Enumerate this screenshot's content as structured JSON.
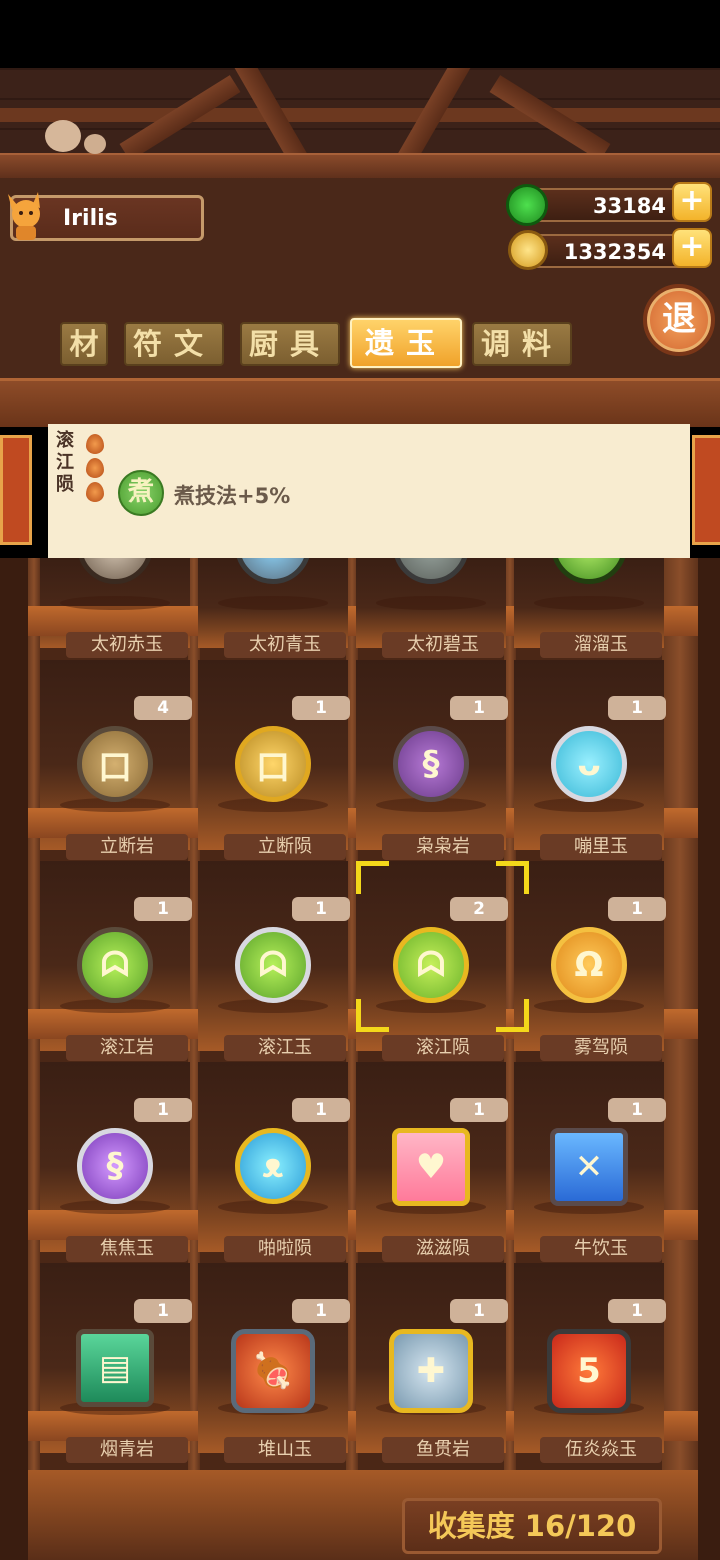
{
  "player": {
    "name": "Irilis"
  },
  "resources": {
    "jade": {
      "value": "33184",
      "icon": "green-jade-icon"
    },
    "coins": {
      "value": "1332354",
      "icon": "copper-coin-icon"
    }
  },
  "exit_label": "退",
  "tabs": [
    {
      "label": "材",
      "active": false
    },
    {
      "label": "符文",
      "active": false
    },
    {
      "label": "厨具",
      "active": false
    },
    {
      "label": "遗玉",
      "active": true
    },
    {
      "label": "调料",
      "active": false
    }
  ],
  "info": {
    "name": "滚江陨",
    "skill_icon_text": "煮",
    "skill_text": "煮技法+5%"
  },
  "items": [
    {
      "name": "太初赤玉",
      "count": ""
    },
    {
      "name": "太初青玉",
      "count": ""
    },
    {
      "name": "太初碧玉",
      "count": ""
    },
    {
      "name": "溜溜玉",
      "count": ""
    },
    {
      "name": "立断岩",
      "count": "4"
    },
    {
      "name": "立断陨",
      "count": "1"
    },
    {
      "name": "枭枭岩",
      "count": "1"
    },
    {
      "name": "嘣里玉",
      "count": "1"
    },
    {
      "name": "滚江岩",
      "count": "1"
    },
    {
      "name": "滚江玉",
      "count": "1"
    },
    {
      "name": "滚江陨",
      "count": "2"
    },
    {
      "name": "雾驾陨",
      "count": "1"
    },
    {
      "name": "焦焦玉",
      "count": "1"
    },
    {
      "name": "啪啦陨",
      "count": "1"
    },
    {
      "name": "滋滋陨",
      "count": "1"
    },
    {
      "name": "牛饮玉",
      "count": "1"
    },
    {
      "name": "烟青岩",
      "count": "1"
    },
    {
      "name": "堆山玉",
      "count": "1"
    },
    {
      "name": "鱼贯岩",
      "count": "1"
    },
    {
      "name": "伍炎焱玉",
      "count": "1"
    }
  ],
  "collection": "收集度 16/120",
  "colors": {
    "accent_gold": "#f0a22a",
    "selector_yellow": "#f4d81a",
    "panel_cream": "#f8ecd0"
  }
}
